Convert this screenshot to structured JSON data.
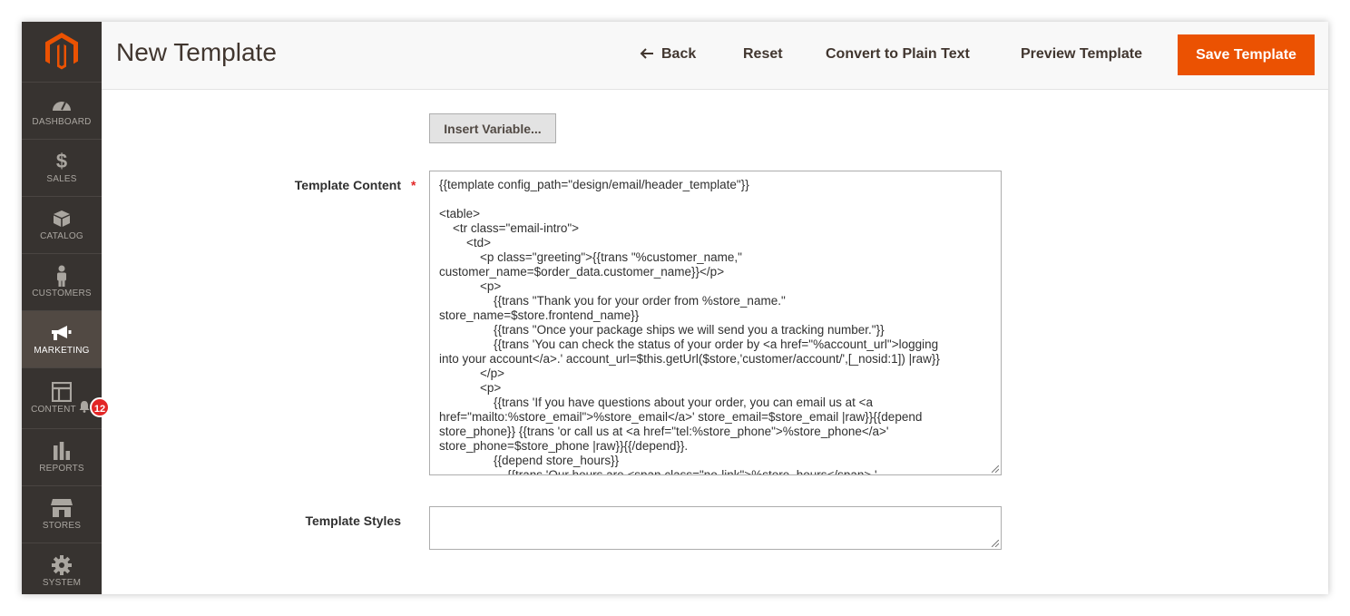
{
  "header": {
    "title": "New Template",
    "back_label": "Back",
    "reset_label": "Reset",
    "convert_label": "Convert to Plain Text",
    "preview_label": "Preview Template",
    "save_label": "Save Template"
  },
  "sidebar": {
    "items": [
      {
        "label": "DASHBOARD",
        "icon": "dashboard-icon"
      },
      {
        "label": "SALES",
        "icon": "dollar-icon"
      },
      {
        "label": "CATALOG",
        "icon": "box-icon"
      },
      {
        "label": "CUSTOMERS",
        "icon": "person-icon"
      },
      {
        "label": "MARKETING",
        "icon": "megaphone-icon",
        "active": true
      },
      {
        "label": "CONTENT",
        "icon": "layout-icon"
      },
      {
        "label": "REPORTS",
        "icon": "bar-chart-icon"
      },
      {
        "label": "STORES",
        "icon": "storefront-icon"
      },
      {
        "label": "SYSTEM",
        "icon": "gear-icon"
      }
    ],
    "notification_count": "12"
  },
  "form": {
    "insert_variable_label": "Insert Variable...",
    "template_content_label": "Template Content",
    "template_styles_label": "Template Styles",
    "required_mark": "*",
    "template_content_lines": [
      "{{template config_path=\"design/email/header_template\"}}",
      "",
      "<table>",
      "    <tr class=\"email-intro\">",
      "        <td>",
      "            <p class=\"greeting\">{{trans \"%customer_name,\"",
      "customer_name=$order_data.customer_name}}</p>",
      "            <p>",
      "                {{trans \"Thank you for your order from %store_name.\"",
      "store_name=$store.frontend_name}}",
      "                {{trans \"Once your package ships we will send you a tracking number.\"}}",
      "                {{trans 'You can check the status of your order by <a href=\"%account_url\">logging",
      "into your account</a>.' account_url=$this.getUrl($store,'customer/account/',[_nosid:1]) |raw}}",
      "            </p>",
      "            <p>",
      "                {{trans 'If you have questions about your order, you can email us at <a",
      "href=\"mailto:%store_email\">%store_email</a>' store_email=$store_email |raw}}{{depend",
      "store_phone}} {{trans 'or call us at <a href=\"tel:%store_phone\">%store_phone</a>'",
      "store_phone=$store_phone |raw}}{{/depend}}.",
      "                {{depend store_hours}}",
      "                    {{trans 'Our hours are <span class=\"no-link\">%store_hours</span>.'"
    ],
    "template_styles_value": ""
  },
  "colors": {
    "accent": "#eb5202",
    "sidebar_bg": "#373330",
    "sidebar_active": "#514943",
    "badge": "#e22626"
  }
}
